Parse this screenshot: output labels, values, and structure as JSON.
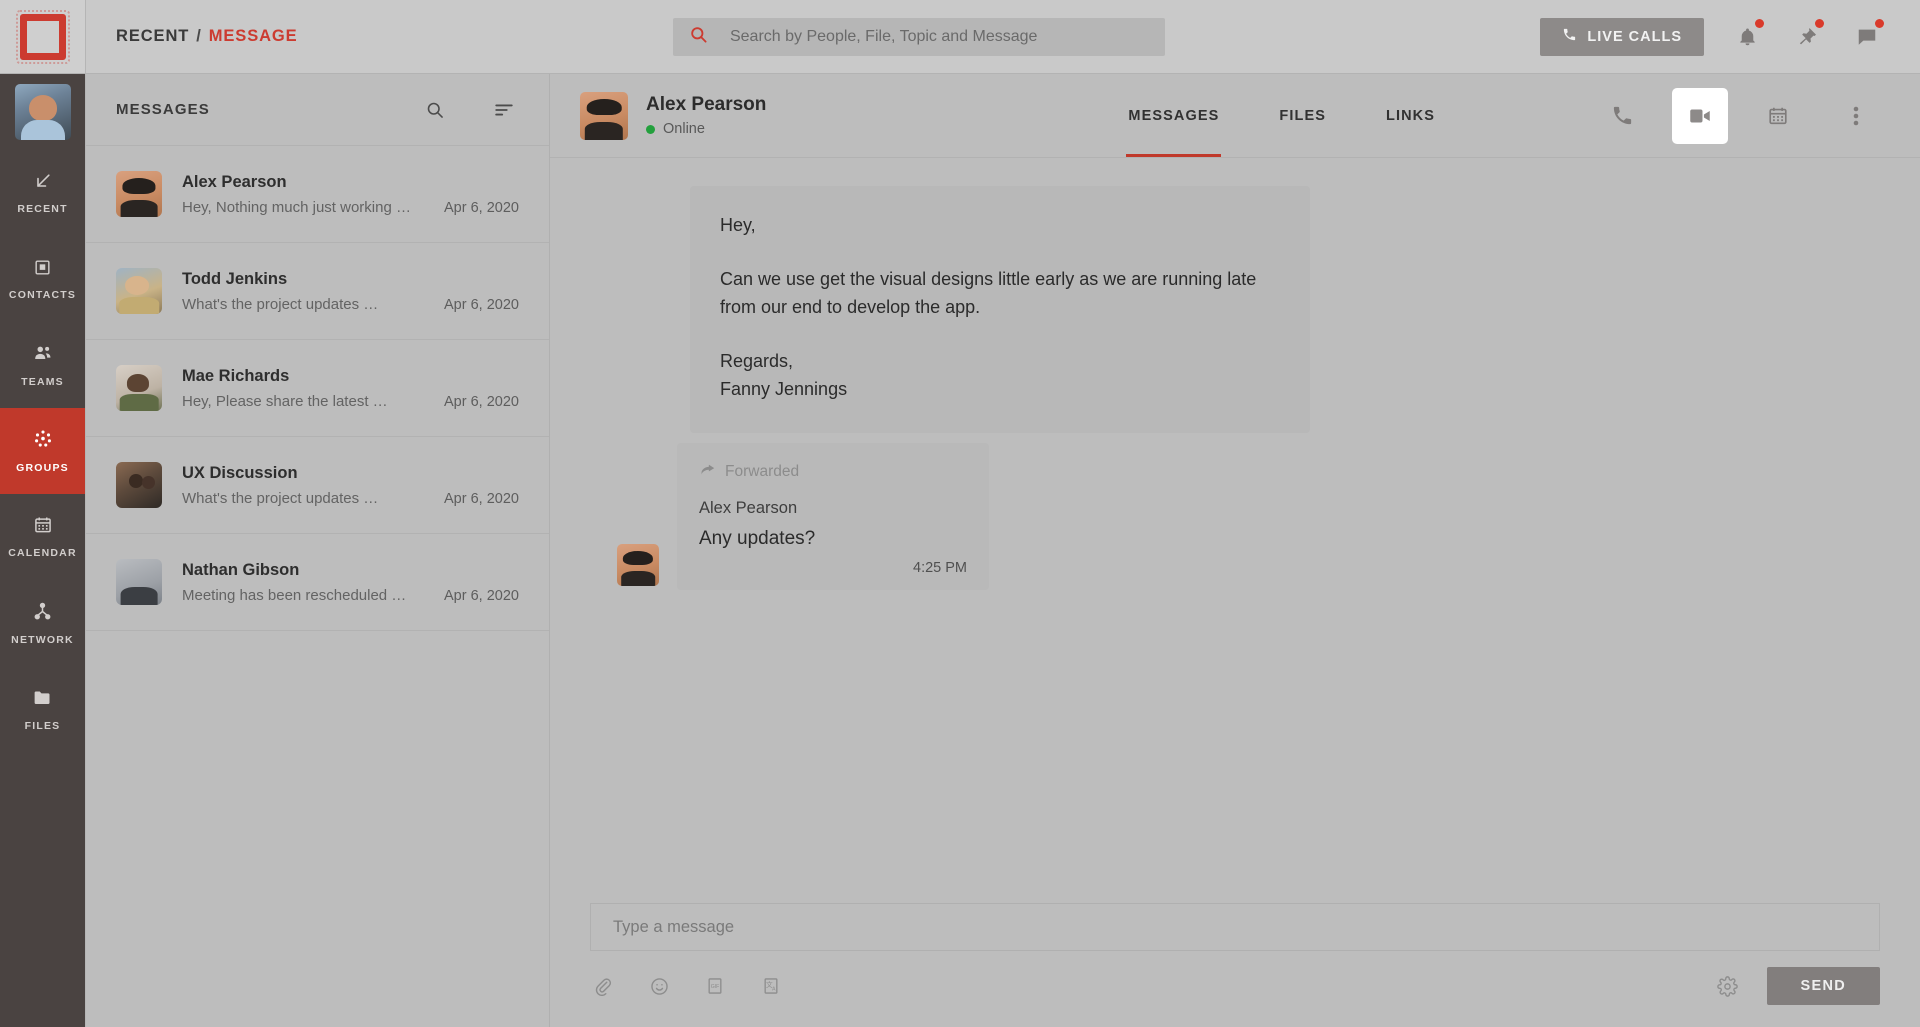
{
  "topbar": {
    "logo_name": "app-logo",
    "breadcrumb": {
      "root": "RECENT",
      "separator": "/",
      "current": "MESSAGE"
    },
    "search": {
      "placeholder": "Search by People, File, Topic and Message",
      "value": ""
    },
    "live_calls_label": "LIVE CALLS",
    "icons": [
      {
        "name": "notifications-bell-icon",
        "badge": true
      },
      {
        "name": "pin-icon",
        "badge": true
      },
      {
        "name": "chat-icon",
        "badge": true
      }
    ]
  },
  "sidebar": {
    "avatar_name": "current-user-avatar",
    "active": "GROUPS",
    "items": [
      {
        "label": "RECENT",
        "icon": "arrow-down-left-icon"
      },
      {
        "label": "CONTACTS",
        "icon": "contact-card-icon"
      },
      {
        "label": "TEAMS",
        "icon": "people-icon"
      },
      {
        "label": "GROUPS",
        "icon": "group-dots-icon"
      },
      {
        "label": "CALENDAR",
        "icon": "calendar-icon"
      },
      {
        "label": "NETWORK",
        "icon": "network-nodes-icon"
      },
      {
        "label": "FILES",
        "icon": "folder-icon"
      }
    ]
  },
  "message_list": {
    "title": "MESSAGES",
    "search_icon": "search-icon",
    "filter_icon": "sort-filter-icon",
    "conversations": [
      {
        "name": "Alex Pearson",
        "preview": "Hey, Nothing much just working …",
        "date": "Apr 6, 2020",
        "avatar": "ph-alex"
      },
      {
        "name": "Todd Jenkins",
        "preview": "What's the project updates …",
        "date": "Apr 6, 2020",
        "avatar": "ph-todd"
      },
      {
        "name": "Mae Richards",
        "preview": "Hey, Please share the latest …",
        "date": "Apr 6, 2020",
        "avatar": "ph-mae"
      },
      {
        "name": "UX Discussion",
        "preview": "What's the project updates …",
        "date": "Apr 6, 2020",
        "avatar": "ph-ux"
      },
      {
        "name": "Nathan Gibson",
        "preview": "Meeting has been rescheduled …",
        "date": "Apr 6, 2020",
        "avatar": "ph-nathan"
      }
    ]
  },
  "chat": {
    "contact_name": "Alex Pearson",
    "status": "Online",
    "status_color": "#23a03d",
    "tabs": [
      {
        "label": "MESSAGES",
        "active": true
      },
      {
        "label": "FILES",
        "active": false
      },
      {
        "label": "LINKS",
        "active": false
      }
    ],
    "actions": [
      {
        "name": "phone-call-icon",
        "active": false
      },
      {
        "name": "video-call-icon",
        "active": true
      },
      {
        "name": "calendar-icon",
        "active": false
      },
      {
        "name": "more-options-icon",
        "active": false
      }
    ],
    "messages": {
      "long_bubble": {
        "line1": "Hey,",
        "line2": "Can we use get the visual designs little early as we are running late from our end to develop the app.",
        "line3": "Regards,",
        "line4": "Fanny Jennings"
      },
      "forwarded": {
        "label": "Forwarded",
        "icon": "forward-arrow-icon",
        "sender": "Alex Pearson",
        "text": "Any updates?",
        "time": "4:25 PM"
      }
    }
  },
  "composer": {
    "placeholder": "Type a message",
    "value": "",
    "tools": [
      {
        "name": "attachment-clip-icon"
      },
      {
        "name": "emoji-smiley-icon"
      },
      {
        "name": "gif-icon"
      },
      {
        "name": "translate-icon"
      }
    ],
    "settings_icon": "gear-icon",
    "send_label": "SEND"
  },
  "colors": {
    "accent": "#c0392b",
    "background": "#bdbdbd",
    "sidebar": "#4a4341",
    "status_online": "#23a03d"
  }
}
